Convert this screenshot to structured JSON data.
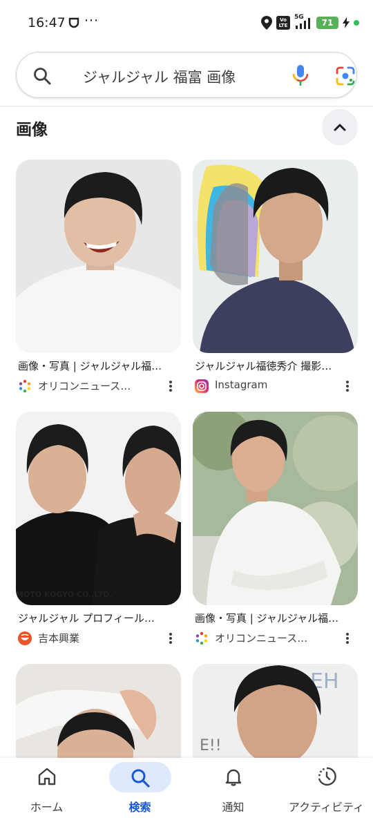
{
  "status_bar": {
    "time": "16:47",
    "dots": "···",
    "network": "5G",
    "volte": "Vo LTE",
    "battery": "71"
  },
  "search": {
    "query": "ジャルジャル 福富 画像",
    "icons": [
      "search-icon",
      "mic-icon",
      "google-lens-icon"
    ]
  },
  "section": {
    "title": "画像"
  },
  "results": [
    {
      "caption": "画像・写真 | ジャルジャル福…",
      "source": "オリコンニュース…",
      "source_icon": "oricon-icon"
    },
    {
      "caption": "ジャルジャル福徳秀介 撮影…",
      "source": "Instagram",
      "source_icon": "instagram-icon"
    },
    {
      "caption": "ジャルジャル プロフィール…",
      "source": "吉本興業",
      "source_icon": "yoshimoto-icon",
      "watermark": "MOTO KOGYO CO.,LTD."
    },
    {
      "caption": "画像・写真 | ジャルジャル福…",
      "source": "オリコンニュース…",
      "source_icon": "oricon-icon"
    },
    {
      "caption": "",
      "source": ""
    },
    {
      "caption": "",
      "source": "",
      "backdrop_text": "EH",
      "backdrop_text2": "E!!"
    }
  ],
  "bottom_nav": [
    {
      "label": "ホーム",
      "icon": "home-icon",
      "active": false
    },
    {
      "label": "検索",
      "icon": "search-icon",
      "active": true
    },
    {
      "label": "通知",
      "icon": "bell-icon",
      "active": false
    },
    {
      "label": "アクティビティ",
      "icon": "activity-icon",
      "active": false
    }
  ],
  "colors": {
    "accent": "#1a56d6",
    "nav_pill": "#dfe9fd",
    "battery": "#58b15a"
  }
}
